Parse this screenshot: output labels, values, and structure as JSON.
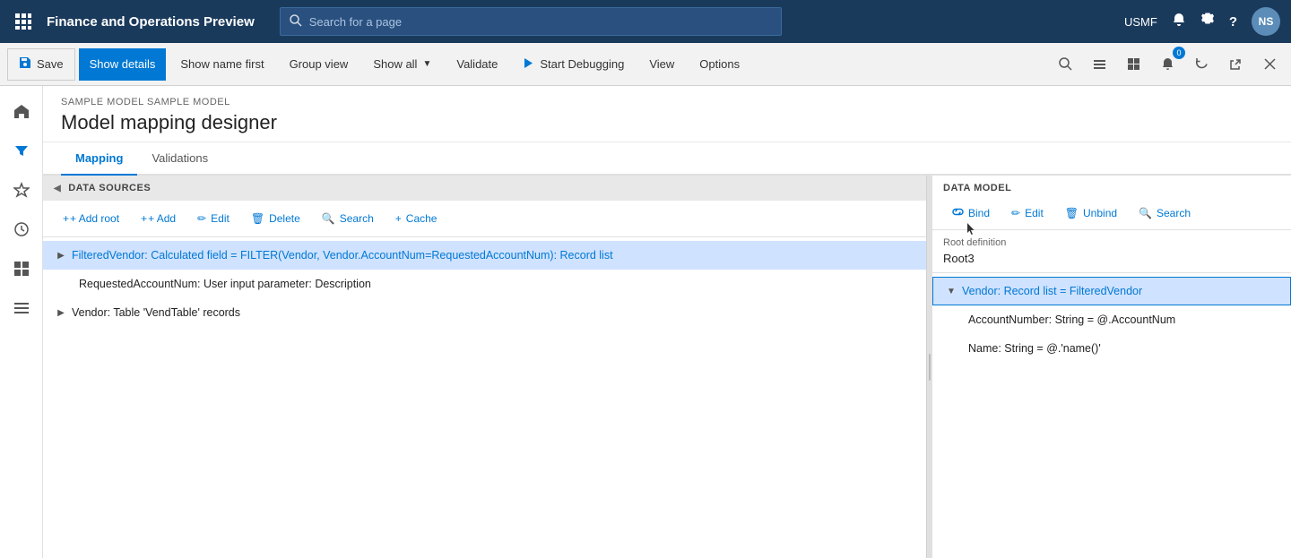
{
  "app": {
    "title": "Finance and Operations Preview",
    "env": "USMF"
  },
  "search": {
    "placeholder": "Search for a page"
  },
  "toolbar": {
    "save_label": "Save",
    "show_details_label": "Show details",
    "show_name_first_label": "Show name first",
    "group_view_label": "Group view",
    "show_all_label": "Show all",
    "validate_label": "Validate",
    "start_debugging_label": "Start Debugging",
    "view_label": "View",
    "options_label": "Options",
    "badge_count": "0"
  },
  "breadcrumb": {
    "text": "SAMPLE MODEL SAMPLE MODEL"
  },
  "page_title": "Model mapping designer",
  "tabs": [
    {
      "id": "mapping",
      "label": "Mapping",
      "active": true
    },
    {
      "id": "validations",
      "label": "Validations",
      "active": false
    }
  ],
  "data_sources": {
    "header": "DATA SOURCES",
    "toolbar": {
      "add_root": "+ Add root",
      "add": "+ Add",
      "edit": "Edit",
      "delete": "Delete",
      "search": "Search",
      "cache": "Cache"
    },
    "items": [
      {
        "id": "filtered_vendor",
        "text": "FilteredVendor: Calculated field = FILTER(Vendor, Vendor.AccountNum=RequestedAccountNum): Record list",
        "indent": 0,
        "has_children": true,
        "expanded": false,
        "selected": true
      },
      {
        "id": "requested_account_num",
        "text": "RequestedAccountNum: User input parameter: Description",
        "indent": 1,
        "has_children": false,
        "expanded": false,
        "selected": false
      },
      {
        "id": "vendor",
        "text": "Vendor: Table 'VendTable' records",
        "indent": 0,
        "has_children": true,
        "expanded": false,
        "selected": false
      }
    ]
  },
  "data_model": {
    "header": "DATA MODEL",
    "toolbar": {
      "bind": "Bind",
      "edit": "Edit",
      "unbind": "Unbind",
      "search": "Search"
    },
    "root_definition_label": "Root definition",
    "root_definition_value": "Root3",
    "items": [
      {
        "id": "vendor_record",
        "text": "Vendor: Record list = FilteredVendor",
        "indent": 0,
        "has_children": true,
        "expanded": true,
        "selected": true
      },
      {
        "id": "account_number",
        "text": "AccountNumber: String = @.AccountNum",
        "indent": 1,
        "has_children": false,
        "expanded": false,
        "selected": false
      },
      {
        "id": "name",
        "text": "Name: String = @.'name()'",
        "indent": 1,
        "has_children": false,
        "expanded": false,
        "selected": false
      }
    ]
  },
  "icons": {
    "grid": "⊞",
    "search": "🔍",
    "bell": "🔔",
    "gear": "⚙",
    "question": "?",
    "save": "💾",
    "filter": "▼",
    "debug": "🐞",
    "home": "⌂",
    "star": "☆",
    "clock": "🕐",
    "table": "▦",
    "list": "≡",
    "expand": "▶",
    "collapse": "▼",
    "close": "✕",
    "refresh": "↺",
    "share": "↗",
    "maximize": "⤢",
    "pin": "📌",
    "book": "📖",
    "plus": "+",
    "bind_icon": "🔗",
    "edit_icon": "✏",
    "unbind_icon": "🗑",
    "search_icon": "🔍",
    "cache_icon": "⚡"
  }
}
